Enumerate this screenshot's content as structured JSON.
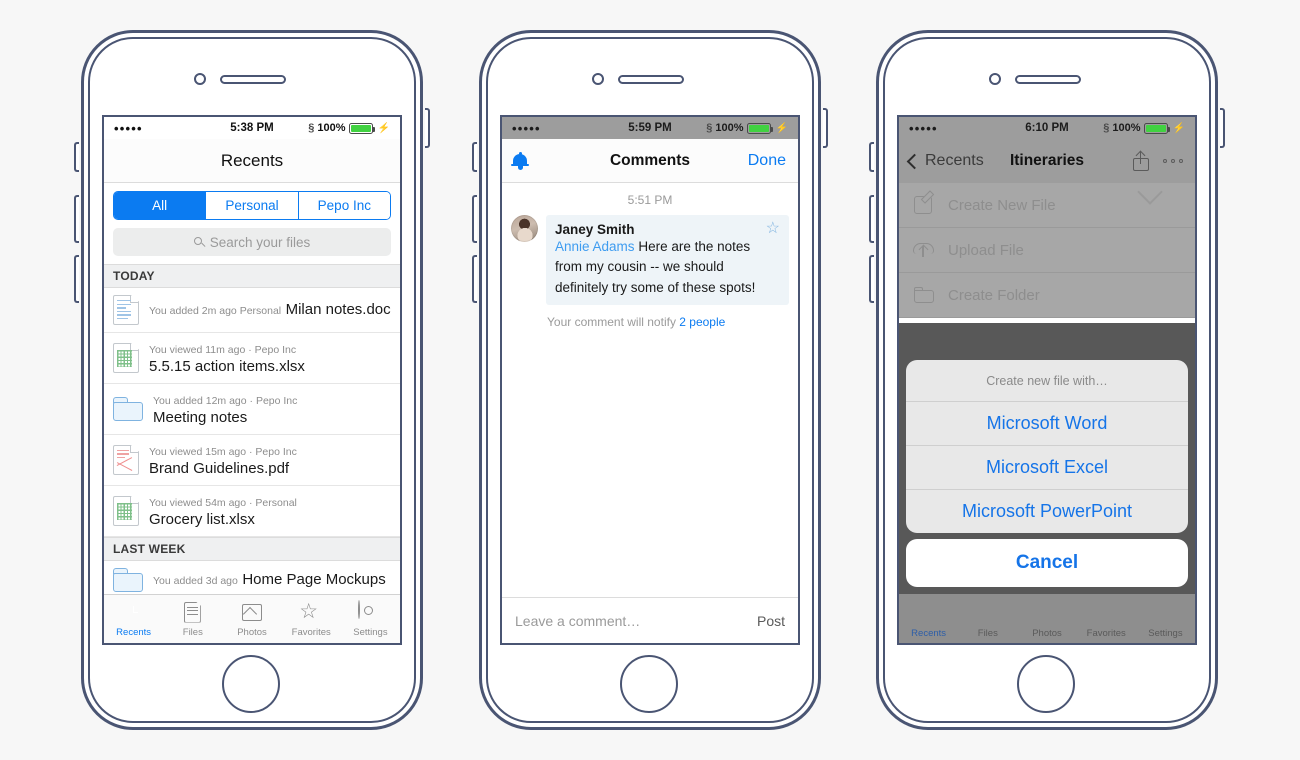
{
  "phone1": {
    "status": {
      "dots": "•••••",
      "time": "5:38 PM",
      "bluetooth": "bluetooth-icon",
      "battery_pct": "100%",
      "charging": "⚡"
    },
    "nav": {
      "title": "Recents"
    },
    "segmented": {
      "options": [
        "All",
        "Personal",
        "Pepo Inc"
      ],
      "selected": "All"
    },
    "search": {
      "placeholder": "Search your files",
      "icon": "search-icon"
    },
    "sections": [
      {
        "header": "TODAY",
        "rows": [
          {
            "icon": "doc-file-icon",
            "meta": "You added 2m ago  Personal",
            "name": "Milan notes.doc"
          },
          {
            "icon": "xlsx-file-icon",
            "meta": "You viewed 11m ago · Pepo Inc",
            "name": "5.5.15 action items.xlsx"
          },
          {
            "icon": "folder-icon",
            "meta": "You added 12m ago · Pepo Inc",
            "name": "Meeting notes"
          },
          {
            "icon": "pdf-file-icon",
            "meta": "You viewed 15m ago · Pepo Inc",
            "name": "Brand Guidelines.pdf"
          },
          {
            "icon": "xlsx-file-icon",
            "meta": "You viewed 54m ago · Personal",
            "name": "Grocery list.xlsx"
          }
        ]
      },
      {
        "header": "LAST WEEK",
        "rows": [
          {
            "icon": "folder-icon",
            "meta": "You added 3d ago",
            "name": "Home Page Mockups"
          }
        ]
      }
    ],
    "tabbar": {
      "active": "Recents",
      "tabs": [
        {
          "icon": "clock-icon",
          "label": "Recents"
        },
        {
          "icon": "document-icon",
          "label": "Files"
        },
        {
          "icon": "photo-icon",
          "label": "Photos"
        },
        {
          "icon": "star-icon",
          "label": "Favorites"
        },
        {
          "icon": "gear-icon",
          "label": "Settings"
        }
      ]
    }
  },
  "phone2": {
    "status": {
      "dots": "•••••",
      "time": "5:59 PM",
      "battery_pct": "100%",
      "charging": "⚡"
    },
    "nav": {
      "bell": "bell-icon",
      "title": "Comments",
      "done": "Done"
    },
    "timestamp": "5:51 PM",
    "comment": {
      "author": "Janey Smith",
      "mention": "Annie Adams",
      "body": "Here are the notes from my cousin -- we should definitely try some of these spots!",
      "star": "star-outline-icon",
      "avatar": "avatar"
    },
    "notify": {
      "prefix": "Your comment will notify ",
      "link": "2 people"
    },
    "composer": {
      "placeholder": "Leave a comment…",
      "post": "Post"
    }
  },
  "phone3": {
    "status": {
      "dots": "•••••",
      "time": "6:10 PM",
      "battery_pct": "100%",
      "charging": "⚡"
    },
    "nav": {
      "back": "Recents",
      "title": "Itineraries",
      "share": "share-icon",
      "more": "more-dots-icon"
    },
    "dropdown": [
      {
        "icon": "create-new-file-icon",
        "label": "Create New File"
      },
      {
        "icon": "upload-file-icon",
        "label": "Upload File"
      },
      {
        "icon": "create-folder-icon",
        "label": "Create Folder"
      }
    ],
    "actionsheet": {
      "title": "Create new file with…",
      "options": [
        "Microsoft Word",
        "Microsoft Excel",
        "Microsoft PowerPoint"
      ],
      "cancel": "Cancel"
    },
    "tabbar": {
      "active": "Recents",
      "tabs": [
        "Recents",
        "Files",
        "Photos",
        "Favorites",
        "Settings"
      ]
    }
  },
  "colors": {
    "accent_blue": "#0b7bf1",
    "action_blue": "#1574e8",
    "frame": "#4a5573",
    "battery_green": "#41d241",
    "page_bg": "#f7f7f7",
    "dim_overlay": "#585858"
  }
}
